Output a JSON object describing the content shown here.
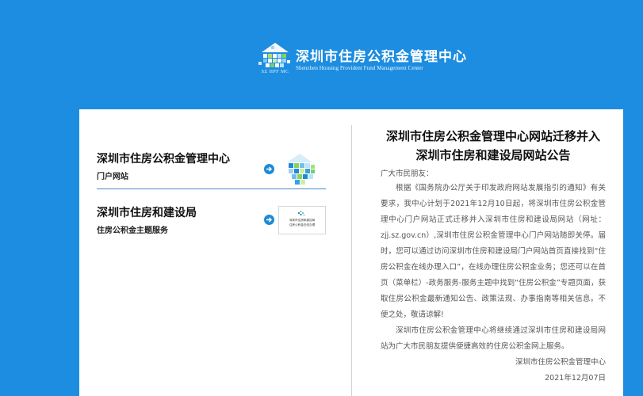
{
  "header": {
    "title": "深圳市住房公积金管理中心",
    "subtitle": "Shenzhen Housing Provident Fund Management Center",
    "logo_abbr": "SZ HPF MC"
  },
  "links": [
    {
      "title": "深圳市住房公积金管理中心",
      "subtitle": "门户网站"
    },
    {
      "title": "深圳市住房和建设局",
      "subtitle": "住房公积金主题服务",
      "thumb_lines": [
        "深圳市住房和建设局",
        "住房公积金在线办理"
      ]
    }
  ],
  "notice": {
    "title_line1": "深圳市住房公积金管理中心网站迁移并入",
    "title_line2": "深圳市住房和建设局网站公告",
    "greeting": "广大市民朋友：",
    "paragraph1": "根据《国务院办公厅关于印发政府网站发展指引的通知》有关要求，我中心计划于2021年12月10日起，将深圳市住房公积金管理中心门户网站正式迁移并入深圳市住房和建设局网站（网址：zjj.sz.gov.cn）,深圳市住房公积金管理中心门户网站随即关停。届时，您可以通过访问深圳市住房和建设局门户网站首页直接找到“住房公积金在线办理入口”，在线办理住房公积金业务；您还可以在首页（菜单栏）-政务服务-服务主题中找到“住房公积金”专题页面，获取住房公积金最新通知公告、政策法规、办事指南等相关信息。不便之处，敬请谅解!",
    "paragraph2": "深圳市住房公积金管理中心将继续通过深圳市住房和建设局网站为广大市民朋友提供便捷高效的住房公积金网上服务。",
    "signature": "深圳市住房公积金管理中心",
    "date": "2021年12月07日"
  },
  "colors": {
    "background": "#1c8de0",
    "panel": "#ffffff",
    "accent": "#1f8ad6",
    "divider_blue": "#4a88c8"
  }
}
